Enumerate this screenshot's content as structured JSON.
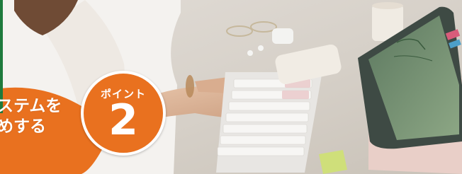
{
  "photo": {
    "scene": "desk-typing-keyboard-tablet",
    "colors": {
      "accent_orange": "#e9711f",
      "rule_green": "#1e7a3c",
      "desk": "#d8d3cc",
      "text": "#ffffff"
    }
  },
  "badge": {
    "label": "ポイント",
    "number": "2"
  },
  "headline": {
    "line1": "ステムを",
    "line2": "めする"
  }
}
